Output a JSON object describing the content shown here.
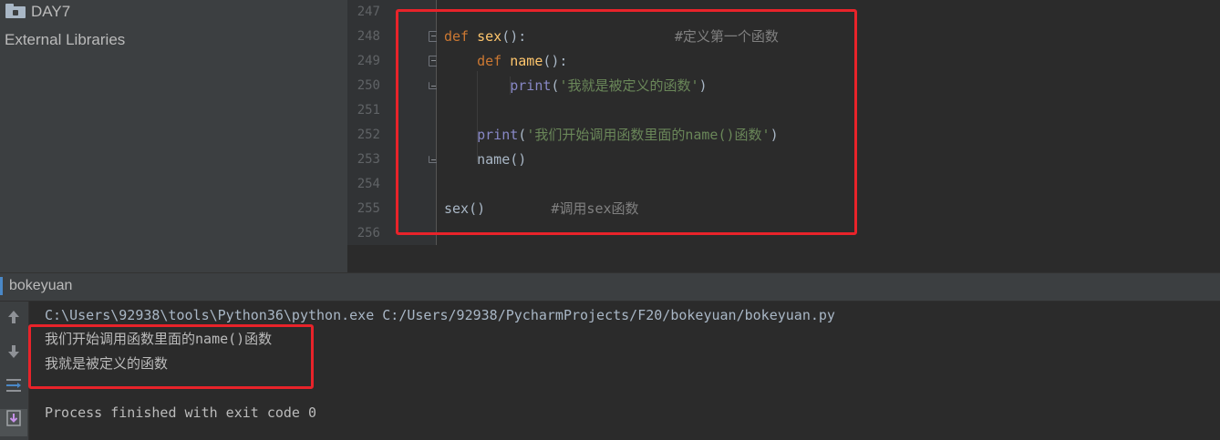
{
  "project_panel": {
    "folder": "DAY7",
    "external_libraries": "External Libraries"
  },
  "editor": {
    "lines": [
      {
        "num": "247"
      },
      {
        "num": "248"
      },
      {
        "num": "249"
      },
      {
        "num": "250"
      },
      {
        "num": "251"
      },
      {
        "num": "252"
      },
      {
        "num": "253"
      },
      {
        "num": "254"
      },
      {
        "num": "255"
      },
      {
        "num": "256"
      }
    ],
    "code": {
      "l248_def": "def",
      "l248_name": "sex",
      "l248_paren": "():",
      "l248_comment": "#定义第一个函数",
      "l249_def": "def",
      "l249_name": "name",
      "l249_paren": "():",
      "l250_print": "print",
      "l250_open": "(",
      "l250_str": "'我就是被定义的函数'",
      "l250_close": ")",
      "l252_print": "print",
      "l252_open": "(",
      "l252_str": "'我们开始调用函数里面的name()函数'",
      "l252_close": ")",
      "l253_call": "name()",
      "l255_call": "sex()",
      "l255_comment": "#调用sex函数"
    }
  },
  "run_panel": {
    "title": "bokeyuan",
    "console": [
      "C:\\Users\\92938\\tools\\Python36\\python.exe C:/Users/92938/PycharmProjects/F20/bokeyuan/bokeyuan.py",
      "我们开始调用函数里面的name()函数",
      "我就是被定义的函数",
      "",
      "Process finished with exit code 0"
    ]
  },
  "colors": {
    "annotation": "#e8232a",
    "keyword": "#cc7832",
    "function_name": "#ffc66d",
    "builtin": "#8888c6",
    "string": "#6a8759",
    "comment": "#808080"
  },
  "icons": [
    "folder-icon",
    "up-arrow-icon",
    "down-arrow-icon",
    "soft-wrap-icon",
    "scroll-to-end-icon"
  ]
}
